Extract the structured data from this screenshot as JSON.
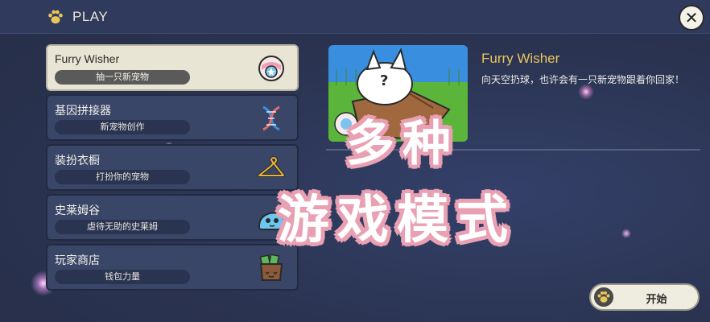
{
  "header": {
    "title": "PLAY",
    "icon": "paw-icon",
    "close_icon": "close-icon",
    "close_glyph": "✕"
  },
  "menu": {
    "items": [
      {
        "title": "Furry Wisher",
        "subtitle": "抽一只新宠物",
        "icon": "gacha-ball-icon",
        "selected": true
      },
      {
        "title": "基因拼接器",
        "subtitle": "新宠物创作",
        "icon": "dna-icon",
        "selected": false
      },
      {
        "title": "装扮衣橱",
        "subtitle": "打扮你的宠物",
        "icon": "hanger-icon",
        "selected": false
      },
      {
        "title": "史莱姆谷",
        "subtitle": "虐待无助的史莱姆",
        "icon": "slime-icon",
        "selected": false
      },
      {
        "title": "玩家商店",
        "subtitle": "钱包力量",
        "icon": "wallet-icon",
        "selected": false
      }
    ]
  },
  "detail": {
    "title": "Furry Wisher",
    "description": "向天空扔球，也许会有一只新宠物跟着你回家！"
  },
  "overlay": {
    "line1": "多种",
    "line2": "游戏模式"
  },
  "start_button": {
    "label": "开始",
    "icon": "paw-icon"
  },
  "colors": {
    "accent_gold": "#e8c75a",
    "overlay_pink": "#e8a0b2",
    "panel": "#3a4668",
    "selected_panel": "#e9e5d4"
  }
}
